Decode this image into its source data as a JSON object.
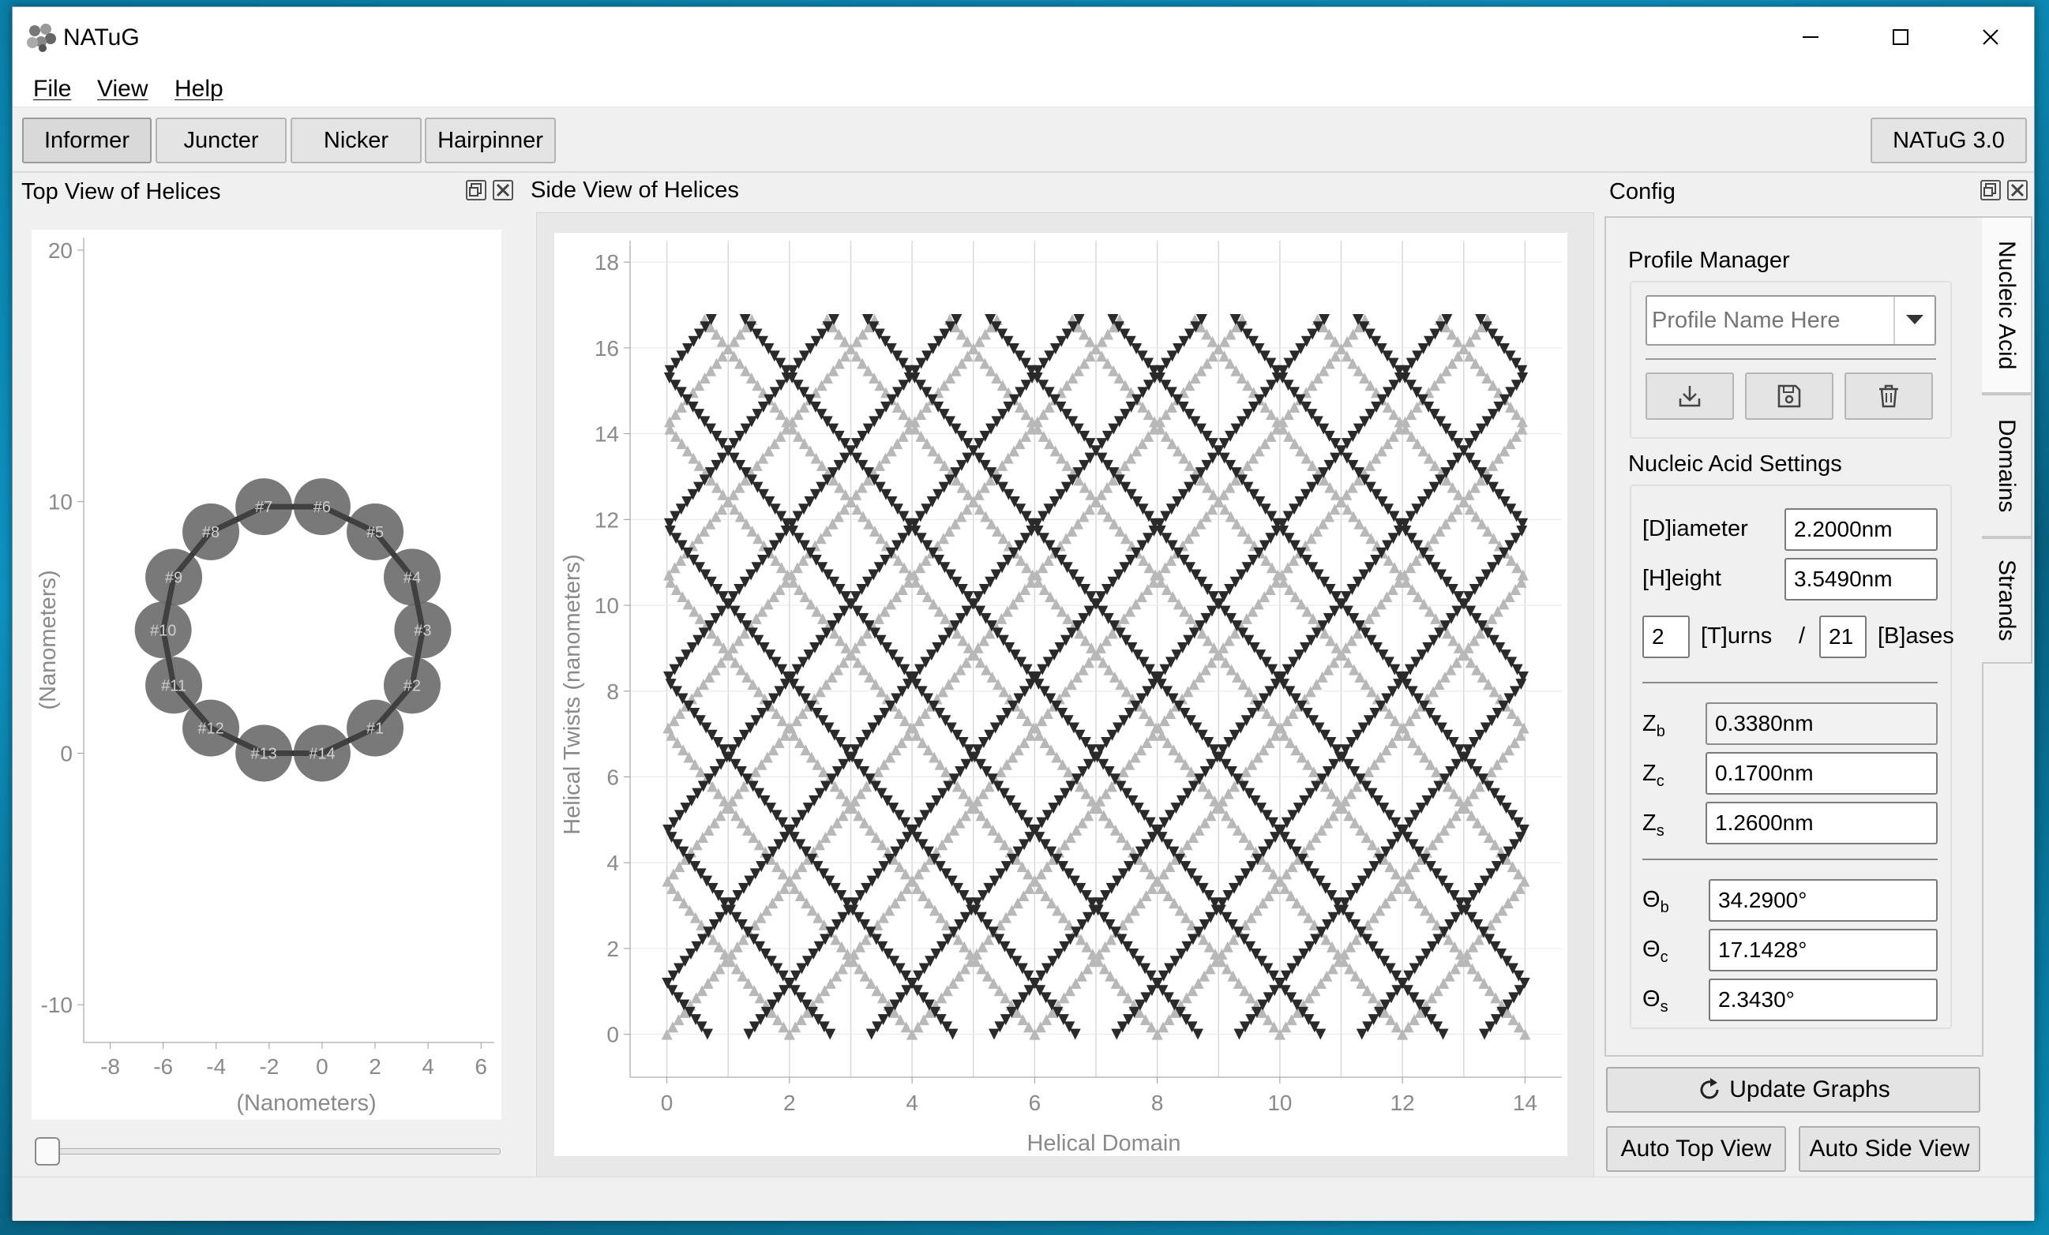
{
  "window": {
    "title": "NATuG"
  },
  "menu": [
    "File",
    "View",
    "Help"
  ],
  "toolbar": {
    "tabs": [
      "Informer",
      "Juncter",
      "Nicker",
      "Hairpinner"
    ],
    "version": "NATuG 3.0"
  },
  "top_view": {
    "title": "Top View of Helices",
    "xlabel": "(Nanometers)",
    "ylabel": "(Nanometers)",
    "x_ticks": [
      "-8",
      "-6",
      "-4",
      "-2",
      "0",
      "2",
      "4",
      "6"
    ],
    "y_ticks": [
      "20",
      "10",
      "0",
      "-10"
    ],
    "xlim": [
      -9,
      6.5
    ],
    "ylim": [
      -11.5,
      20.5
    ],
    "domains": [
      {
        "label": "#1",
        "x": 2.0,
        "y": 1.0
      },
      {
        "label": "#2",
        "x": 3.4,
        "y": 2.7
      },
      {
        "label": "#3",
        "x": 3.8,
        "y": 4.9
      },
      {
        "label": "#4",
        "x": 3.4,
        "y": 7.0
      },
      {
        "label": "#5",
        "x": 2.0,
        "y": 8.8
      },
      {
        "label": "#6",
        "x": 0.0,
        "y": 9.8
      },
      {
        "label": "#7",
        "x": -2.2,
        "y": 9.8
      },
      {
        "label": "#8",
        "x": -4.2,
        "y": 8.8
      },
      {
        "label": "#9",
        "x": -5.6,
        "y": 7.0
      },
      {
        "label": "#10",
        "x": -6.0,
        "y": 4.9
      },
      {
        "label": "#11",
        "x": -5.6,
        "y": 2.7
      },
      {
        "label": "#12",
        "x": -4.2,
        "y": 1.0
      },
      {
        "label": "#13",
        "x": -2.2,
        "y": 0.0
      },
      {
        "label": "#14",
        "x": 0.0,
        "y": 0.0
      }
    ],
    "slider_value": 0
  },
  "side_view": {
    "title": "Side View of Helices",
    "chart_data": {
      "type": "scatter",
      "xlabel": "Helical Domain",
      "ylabel": "Helical Twists (nanometers)",
      "xlim": [
        -0.6,
        14.6
      ],
      "ylim": [
        -1,
        18.5
      ],
      "x_ticks": [
        0,
        2,
        4,
        6,
        8,
        10,
        12,
        14
      ],
      "y_ticks": [
        0,
        2,
        4,
        6,
        8,
        10,
        12,
        14,
        16,
        18
      ],
      "domain_count": 14,
      "height_max": 16.8,
      "zigzag_period": 3.55,
      "series_colors": {
        "up_strand": "#b8b8b8",
        "down_strand": "#2a2a2a"
      }
    }
  },
  "config": {
    "title": "Config",
    "tabs": [
      "Nucleic Acid",
      "Domains",
      "Strands"
    ],
    "profile_manager": {
      "label": "Profile Manager",
      "placeholder": "Profile Name Here"
    },
    "settings_label": "Nucleic Acid Settings",
    "diameter": {
      "label": "[D]iameter",
      "value": "2.2000nm"
    },
    "height": {
      "label": "[H]eight",
      "value": "3.5490nm"
    },
    "turns": {
      "value": "2",
      "label": "[T]urns",
      "sep": "/"
    },
    "bases": {
      "value": "21",
      "label": "[B]ases"
    },
    "z_b": {
      "sym": "Z",
      "sub": "b",
      "value": "0.3380nm"
    },
    "z_c": {
      "sym": "Z",
      "sub": "c",
      "value": "0.1700nm"
    },
    "z_s": {
      "sym": "Z",
      "sub": "s",
      "value": "1.2600nm"
    },
    "theta_b": {
      "sym": "Θ",
      "sub": "b",
      "value": "34.2900°"
    },
    "theta_c": {
      "sym": "Θ",
      "sub": "c",
      "value": "17.1428°"
    },
    "theta_s": {
      "sym": "Θ",
      "sub": "s",
      "value": "2.3430°"
    },
    "update_button": "Update Graphs",
    "auto_top_button": "Auto Top View",
    "auto_side_button": "Auto Side View"
  }
}
